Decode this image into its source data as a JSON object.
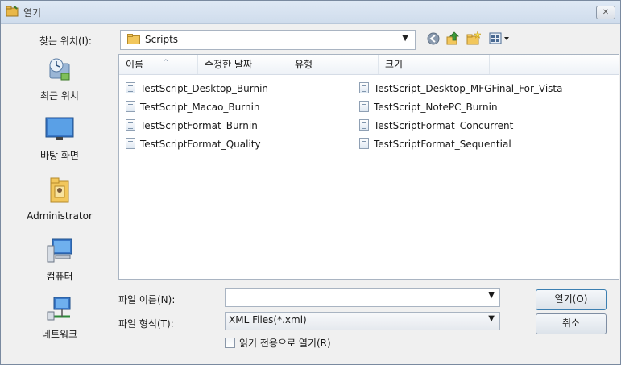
{
  "window": {
    "title": "열기",
    "close_label": "✕"
  },
  "lookin": {
    "label": "찾는 위치(I):",
    "value": "Scripts"
  },
  "places": [
    {
      "label": "최근 위치",
      "icon": "recent-places-icon"
    },
    {
      "label": "바탕 화면",
      "icon": "desktop-icon"
    },
    {
      "label": "Administrator",
      "icon": "user-folder-icon"
    },
    {
      "label": "컴퓨터",
      "icon": "computer-icon"
    },
    {
      "label": "네트워크",
      "icon": "network-icon"
    }
  ],
  "columns": {
    "name": "이름",
    "date": "수정한 날짜",
    "type": "유형",
    "size": "크기"
  },
  "files": [
    "TestScript_Desktop_Burnin",
    "TestScript_Macao_Burnin",
    "TestScriptFormat_Burnin",
    "TestScriptFormat_Quality",
    "TestScript_Desktop_MFGFinal_For_Vista",
    "TestScript_NotePC_Burnin",
    "TestScriptFormat_Concurrent",
    "TestScriptFormat_Sequential"
  ],
  "filename": {
    "label": "파일 이름(N):",
    "value": ""
  },
  "filetype": {
    "label": "파일 형식(T):",
    "value": "XML Files(*.xml)"
  },
  "readonly_label": "읽기 전용으로 열기(R)",
  "buttons": {
    "open": "열기(O)",
    "cancel": "취소"
  },
  "colors": {
    "title_bar": "#dfe9f5",
    "folder": "#e9b84a",
    "accent": "#3c7fb1"
  }
}
